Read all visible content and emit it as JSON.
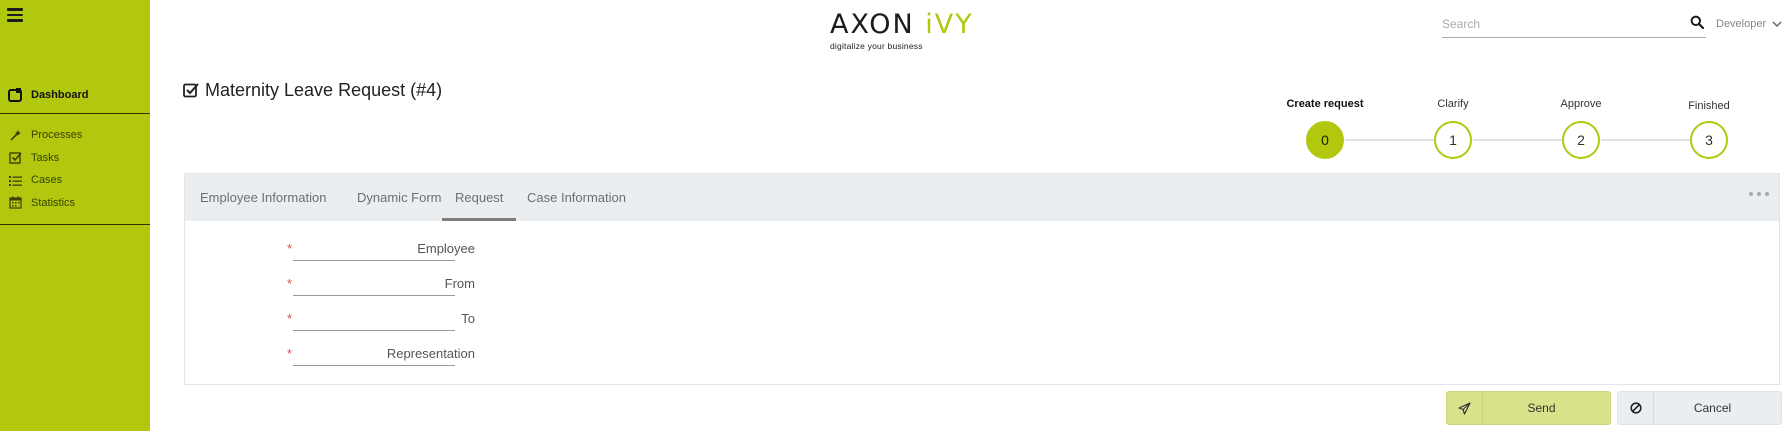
{
  "app": {
    "logo_text": "AXON",
    "logo_accent": "iVY",
    "tagline": "digitalize your business",
    "accent_color": "#b1c80f"
  },
  "header": {
    "search_placeholder": "Search",
    "user_name": "Developer"
  },
  "sidebar": {
    "dashboard_label": "Dashboard",
    "items": [
      {
        "label": "Processes",
        "icon": "wand-icon"
      },
      {
        "label": "Tasks",
        "icon": "check-square-icon"
      },
      {
        "label": "Cases",
        "icon": "list-icon"
      },
      {
        "label": "Statistics",
        "icon": "calendar-icon"
      }
    ]
  },
  "page": {
    "title": "Maternity Leave Request (#4)"
  },
  "stepper": {
    "steps": [
      {
        "label": "Create request",
        "number": "0",
        "active": true
      },
      {
        "label": "Clarify",
        "number": "1",
        "active": false
      },
      {
        "label": "Approve",
        "number": "2",
        "active": false
      },
      {
        "label": "Finished",
        "number": "3",
        "active": false
      }
    ]
  },
  "tabs": [
    {
      "label": "Employee Information",
      "active": false
    },
    {
      "label": "Dynamic Form",
      "active": false
    },
    {
      "label": "Request",
      "active": true
    },
    {
      "label": "Case Information",
      "active": false
    }
  ],
  "form": {
    "required_mark": "*",
    "fields": [
      {
        "label": "Employee",
        "value": ""
      },
      {
        "label": "From",
        "value": ""
      },
      {
        "label": "To",
        "value": ""
      },
      {
        "label": "Representation",
        "value": ""
      }
    ]
  },
  "actions": {
    "send_label": "Send",
    "cancel_label": "Cancel"
  }
}
